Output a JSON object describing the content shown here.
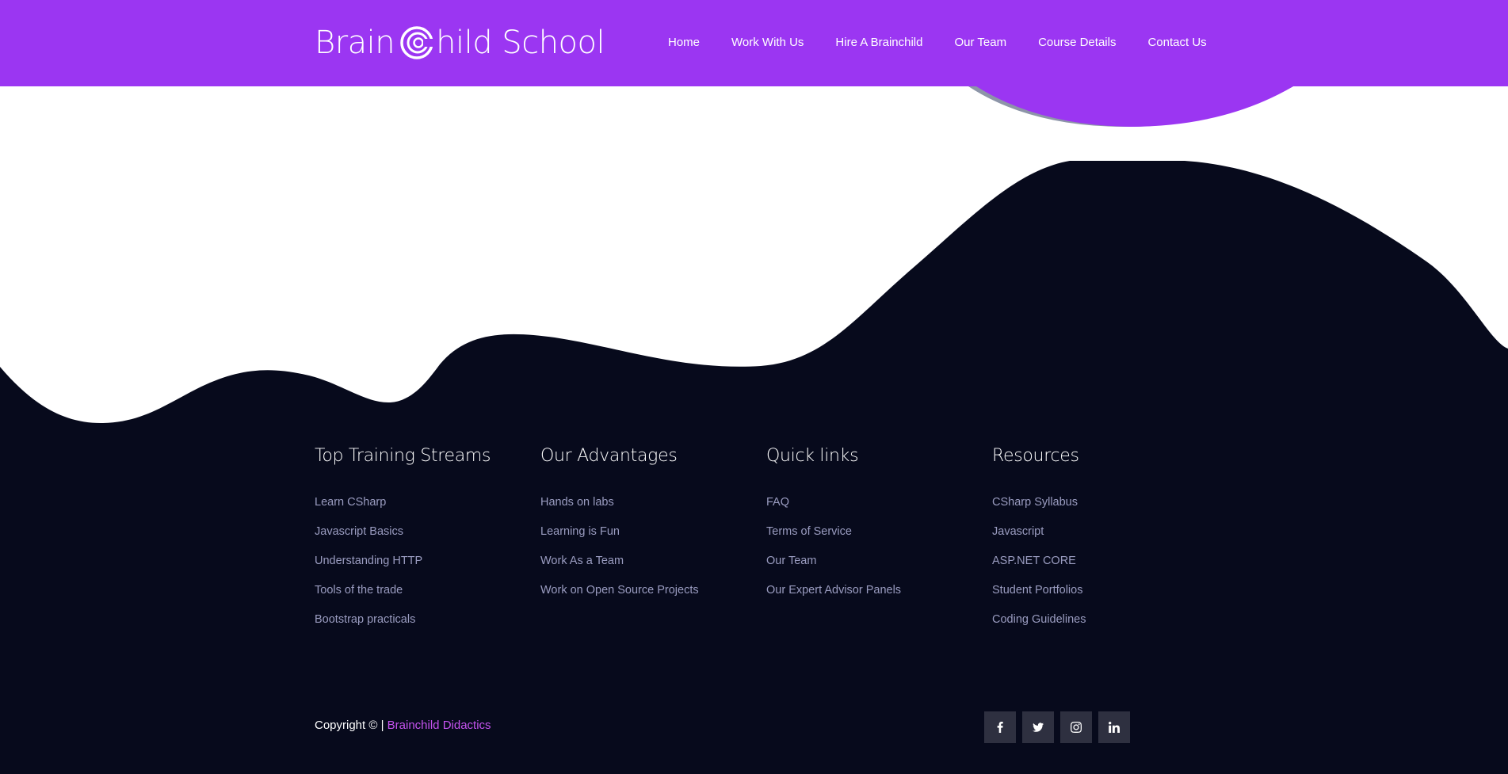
{
  "brand": {
    "logo_text_before": "Brain",
    "logo_text_after": "hild School",
    "header_color": "#9b36f2",
    "footer_color": "#070a1c",
    "accent_link_color": "#c653f0"
  },
  "nav": {
    "items": [
      {
        "label": "Home"
      },
      {
        "label": "Work With Us"
      },
      {
        "label": "Hire A Brainchild"
      },
      {
        "label": "Our Team"
      },
      {
        "label": "Course Details"
      },
      {
        "label": "Contact Us"
      }
    ]
  },
  "footer": {
    "columns": [
      {
        "title": "Top Training Streams",
        "links": [
          "Learn CSharp",
          "Javascript Basics",
          "Understanding HTTP",
          "Tools of the trade",
          "Bootstrap practicals"
        ]
      },
      {
        "title": "Our Advantages",
        "links": [
          "Hands on labs",
          "Learning is Fun",
          "Work As a Team",
          "Work on Open Source Projects"
        ]
      },
      {
        "title": "Quick links",
        "links": [
          "FAQ",
          "Terms of Service",
          "Our Team",
          "Our Expert Advisor Panels"
        ]
      },
      {
        "title": "Resources",
        "links": [
          "CSharp Syllabus",
          "Javascript",
          "ASP.NET CORE",
          "Student Portfolios",
          "Coding Guidelines"
        ]
      }
    ],
    "copyright_prefix": "Copyright © |",
    "copyright_brand": "Brainchild Didactics",
    "socials": [
      {
        "icon": "facebook-icon"
      },
      {
        "icon": "twitter-icon"
      },
      {
        "icon": "instagram-icon"
      },
      {
        "icon": "linkedin-icon"
      }
    ]
  }
}
